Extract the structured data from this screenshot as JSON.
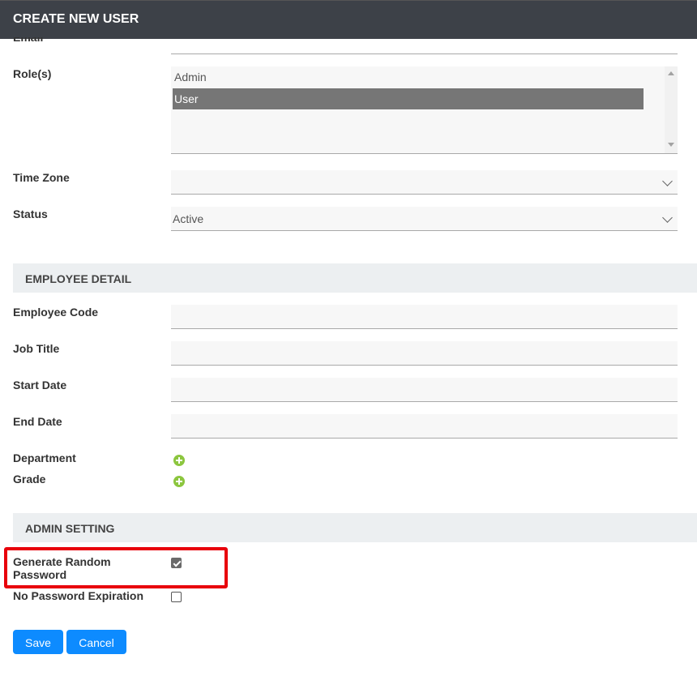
{
  "header": {
    "title": "CREATE NEW USER"
  },
  "form": {
    "email_label": "Email",
    "roles": {
      "label": "Role(s)",
      "options": [
        "Admin",
        "User"
      ],
      "selected": "User"
    },
    "time_zone": {
      "label": "Time Zone",
      "value": ""
    },
    "status": {
      "label": "Status",
      "value": "Active"
    }
  },
  "employee_detail": {
    "title": "EMPLOYEE DETAIL",
    "employee_code_label": "Employee Code",
    "job_title_label": "Job Title",
    "start_date_label": "Start Date",
    "end_date_label": "End Date",
    "department_label": "Department",
    "grade_label": "Grade"
  },
  "admin_setting": {
    "title": "ADMIN SETTING",
    "generate_random_password_label_line1": "Generate Random",
    "generate_random_password_label_line2": "Password",
    "generate_random_password_checked": true,
    "no_password_expiration_label": "No Password Expiration",
    "no_password_expiration_checked": false
  },
  "actions": {
    "save_label": "Save",
    "cancel_label": "Cancel"
  },
  "colors": {
    "header_bg": "#3d4148",
    "primary_button": "#0d8bff",
    "add_icon": "#8cc63f",
    "highlight": "#e8000b",
    "selected_option": "#767676"
  },
  "icons": [
    "add-icon",
    "chevron-down-icon",
    "checkmark-icon"
  ]
}
